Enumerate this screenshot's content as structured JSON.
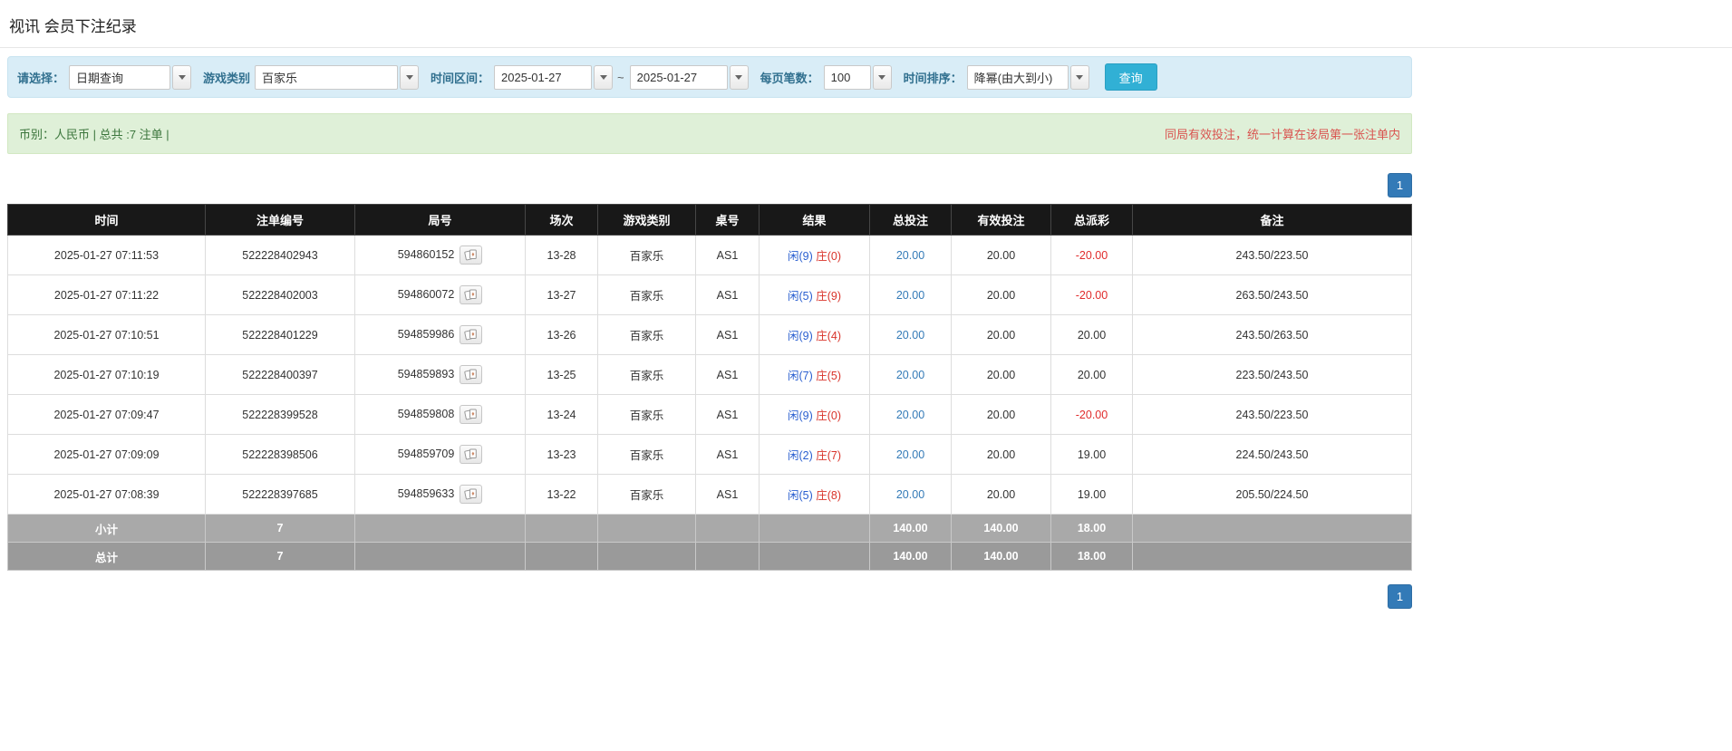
{
  "page": {
    "title": "视讯 会员下注纪录"
  },
  "colors": {
    "filter-bg": "#d9edf7",
    "button-blue": "#31b0d5",
    "link-blue": "#337ab7",
    "player-blue": "#2a5fd0",
    "banker-red": "#d9342b",
    "negative-red": "#e02b2b",
    "notice-red": "#d9534f"
  },
  "filters": {
    "select_label": "请选择：",
    "select_value": "日期查询",
    "game_label": "游戏类别",
    "game_value": "百家乐",
    "range_label": "时间区间：",
    "date_from": "2025-01-27",
    "range_separator": "~",
    "date_to": "2025-01-27",
    "per_page_label": "每页笔数：",
    "per_page_value": "100",
    "sort_label": "时间排序：",
    "sort_value": "降幂(由大到小)",
    "search_button": "查询"
  },
  "info": {
    "summary": "币别：人民币 | 总共 :7 注单 |",
    "notice": "同局有效投注，统一计算在该局第一张注单内"
  },
  "pagination": {
    "page": "1"
  },
  "table": {
    "headers": [
      "时间",
      "注单编号",
      "局号",
      "场次",
      "游戏类别",
      "桌号",
      "结果",
      "总投注",
      "有效投注",
      "总派彩",
      "备注"
    ],
    "rows": [
      {
        "time": "2025-01-27 07:11:53",
        "bet_id": "522228402943",
        "round_id": "594860152",
        "session": "13-28",
        "game": "百家乐",
        "table_no": "AS1",
        "player": "闲(9)",
        "banker": "庄(0)",
        "total_bet": "20.00",
        "valid_bet": "20.00",
        "payout": "-20.00",
        "remark": "243.50/223.50"
      },
      {
        "time": "2025-01-27 07:11:22",
        "bet_id": "522228402003",
        "round_id": "594860072",
        "session": "13-27",
        "game": "百家乐",
        "table_no": "AS1",
        "player": "闲(5)",
        "banker": "庄(9)",
        "total_bet": "20.00",
        "valid_bet": "20.00",
        "payout": "-20.00",
        "remark": "263.50/243.50"
      },
      {
        "time": "2025-01-27 07:10:51",
        "bet_id": "522228401229",
        "round_id": "594859986",
        "session": "13-26",
        "game": "百家乐",
        "table_no": "AS1",
        "player": "闲(9)",
        "banker": "庄(4)",
        "total_bet": "20.00",
        "valid_bet": "20.00",
        "payout": "20.00",
        "remark": "243.50/263.50"
      },
      {
        "time": "2025-01-27 07:10:19",
        "bet_id": "522228400397",
        "round_id": "594859893",
        "session": "13-25",
        "game": "百家乐",
        "table_no": "AS1",
        "player": "闲(7)",
        "banker": "庄(5)",
        "total_bet": "20.00",
        "valid_bet": "20.00",
        "payout": "20.00",
        "remark": "223.50/243.50"
      },
      {
        "time": "2025-01-27 07:09:47",
        "bet_id": "522228399528",
        "round_id": "594859808",
        "session": "13-24",
        "game": "百家乐",
        "table_no": "AS1",
        "player": "闲(9)",
        "banker": "庄(0)",
        "total_bet": "20.00",
        "valid_bet": "20.00",
        "payout": "-20.00",
        "remark": "243.50/223.50"
      },
      {
        "time": "2025-01-27 07:09:09",
        "bet_id": "522228398506",
        "round_id": "594859709",
        "session": "13-23",
        "game": "百家乐",
        "table_no": "AS1",
        "player": "闲(2)",
        "banker": "庄(7)",
        "total_bet": "20.00",
        "valid_bet": "20.00",
        "payout": "19.00",
        "remark": "224.50/243.50"
      },
      {
        "time": "2025-01-27 07:08:39",
        "bet_id": "522228397685",
        "round_id": "594859633",
        "session": "13-22",
        "game": "百家乐",
        "table_no": "AS1",
        "player": "闲(5)",
        "banker": "庄(8)",
        "total_bet": "20.00",
        "valid_bet": "20.00",
        "payout": "19.00",
        "remark": "205.50/224.50"
      }
    ],
    "subtotal": {
      "label": "小计",
      "count": "7",
      "total_bet": "140.00",
      "valid_bet": "140.00",
      "payout": "18.00"
    },
    "total": {
      "label": "总计",
      "count": "7",
      "total_bet": "140.00",
      "valid_bet": "140.00",
      "payout": "18.00"
    }
  }
}
